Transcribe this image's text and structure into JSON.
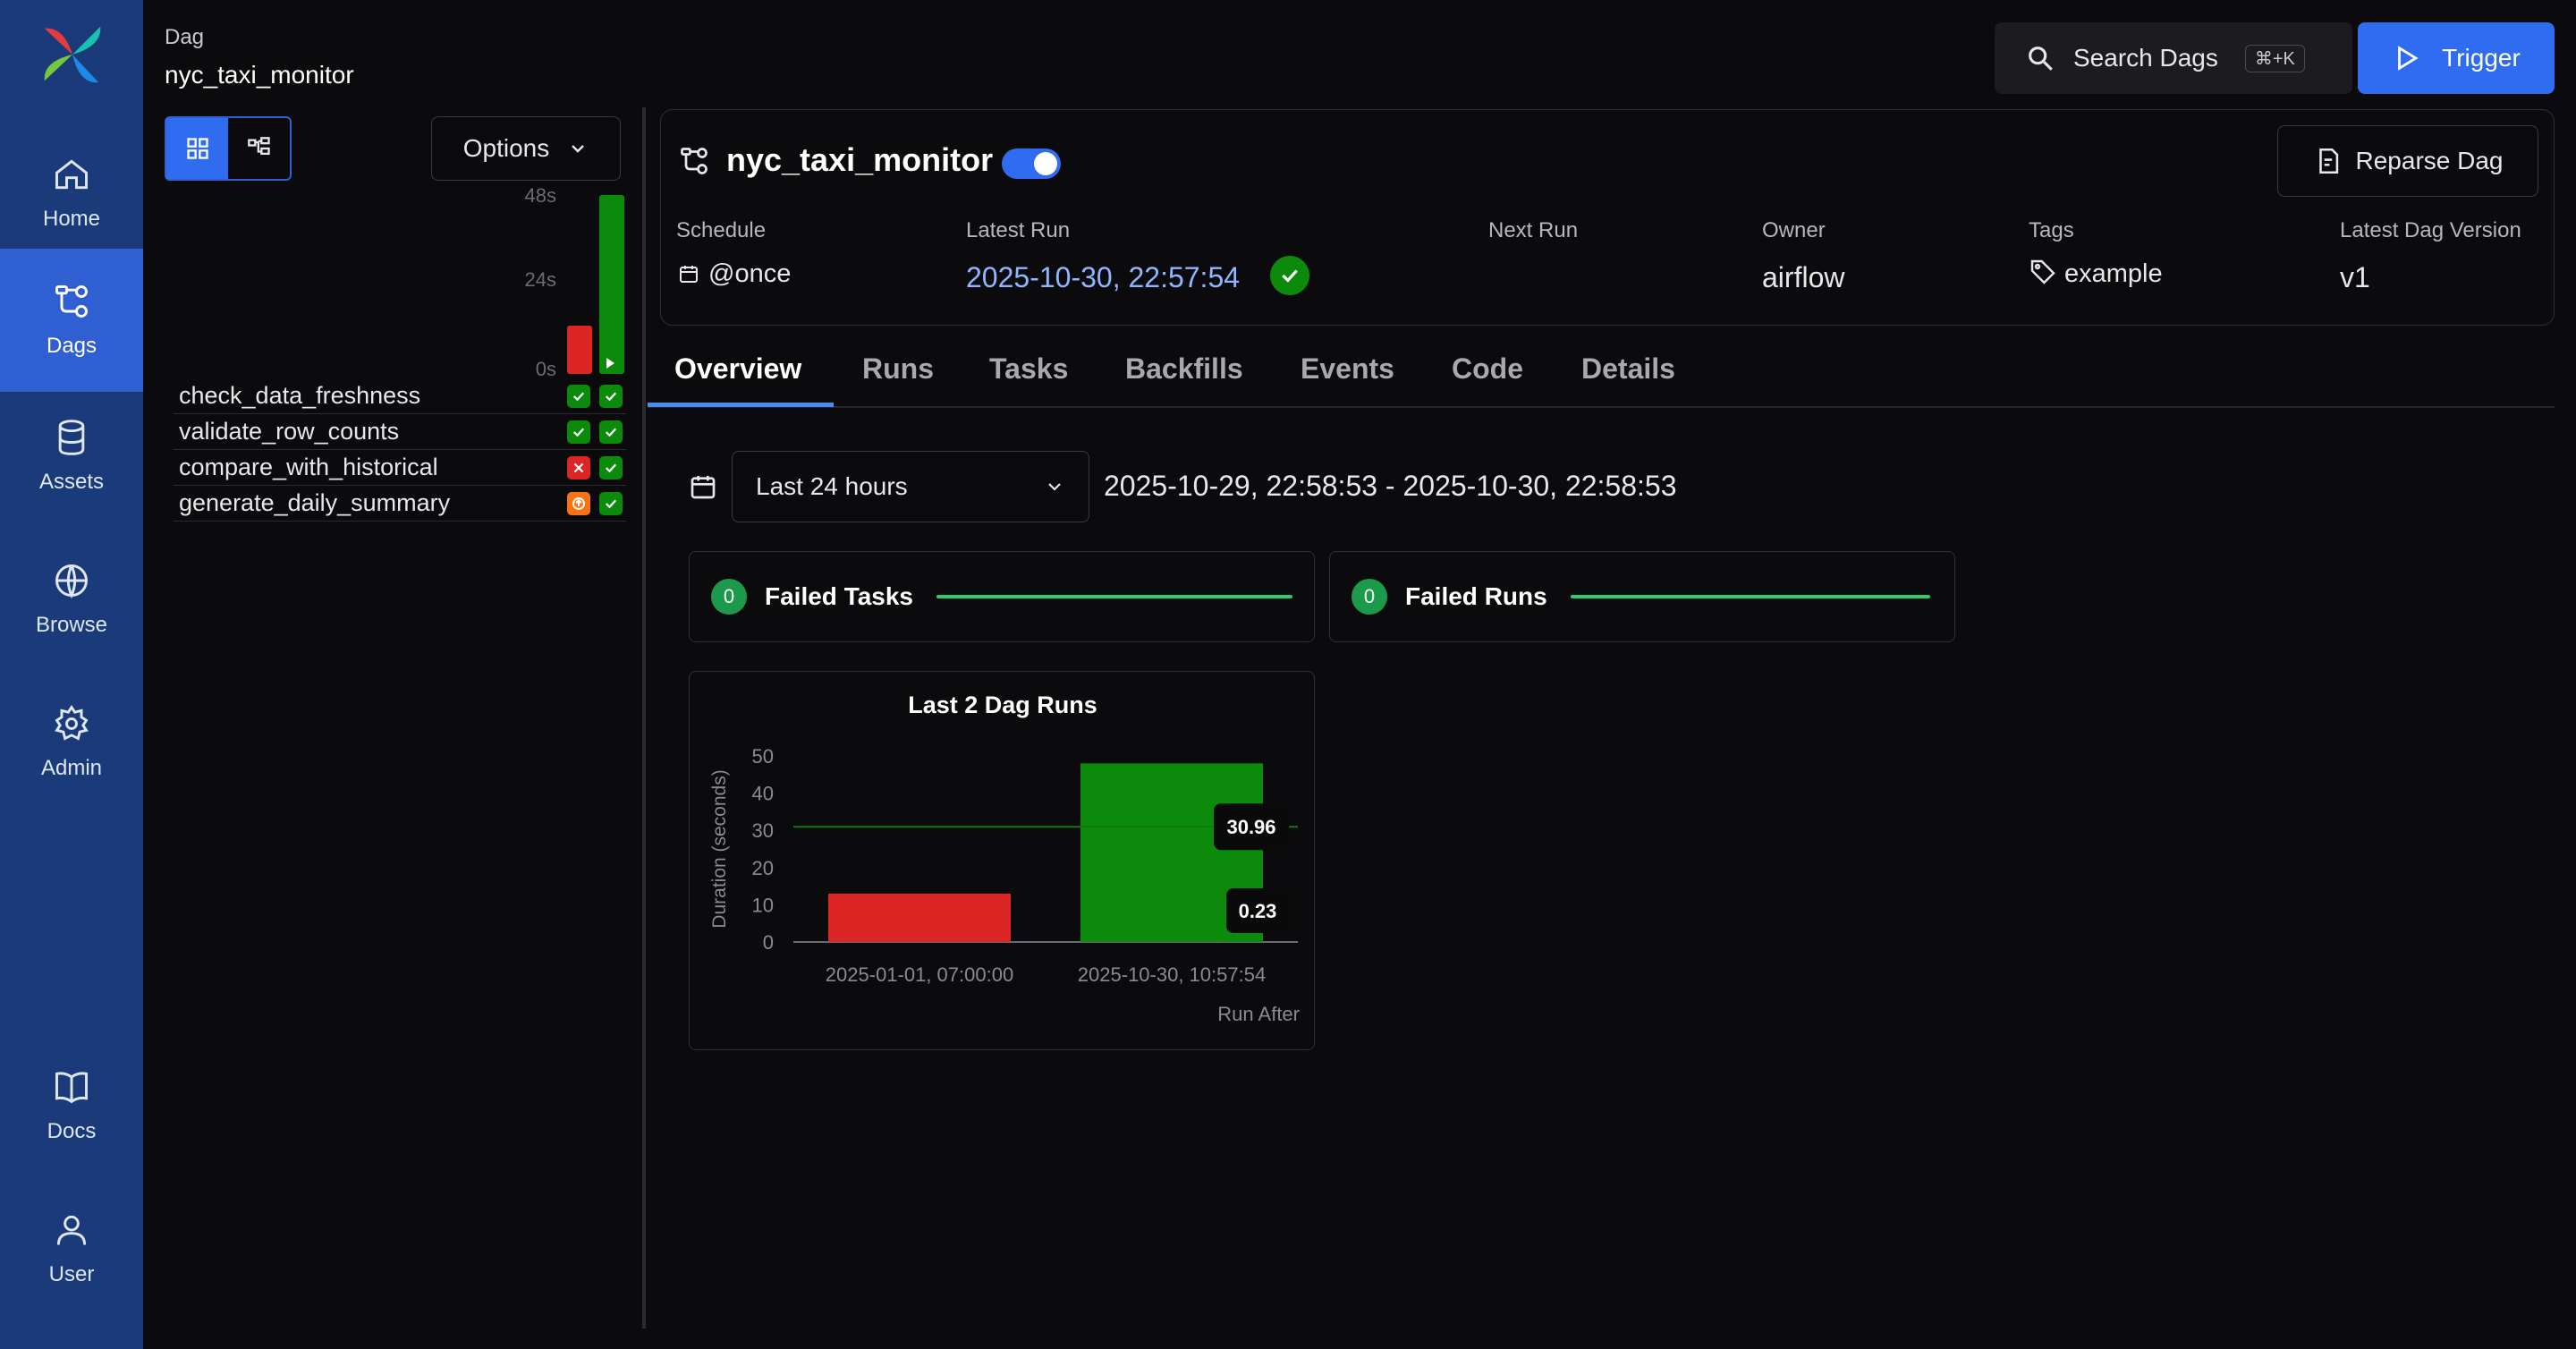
{
  "sidebar": {
    "items": [
      {
        "label": "Home",
        "icon": "home-icon"
      },
      {
        "label": "Dags",
        "icon": "dags-icon",
        "active": true
      },
      {
        "label": "Assets",
        "icon": "database-icon"
      },
      {
        "label": "Browse",
        "icon": "globe-icon"
      },
      {
        "label": "Admin",
        "icon": "gear-icon"
      },
      {
        "label": "Docs",
        "icon": "book-icon"
      },
      {
        "label": "User",
        "icon": "user-icon"
      }
    ]
  },
  "header": {
    "crumb_label": "Dag",
    "dag_id": "nyc_taxi_monitor",
    "search_label": "Search Dags",
    "search_shortcut": "⌘+K",
    "trigger_label": "Trigger"
  },
  "left_panel": {
    "options_label": "Options",
    "duration_ticks": [
      "48s",
      "24s",
      "0s"
    ],
    "tasks": [
      {
        "name": "check_data_freshness",
        "states": [
          "success",
          "success"
        ]
      },
      {
        "name": "validate_row_counts",
        "states": [
          "success",
          "success"
        ]
      },
      {
        "name": "compare_with_historical",
        "states": [
          "failed",
          "success"
        ]
      },
      {
        "name": "generate_daily_summary",
        "states": [
          "upstream_failed",
          "success"
        ]
      }
    ],
    "run_bars": [
      {
        "state": "failed",
        "duration": 0.23
      },
      {
        "state": "success",
        "duration": 30.96
      }
    ]
  },
  "dag_info": {
    "title": "nyc_taxi_monitor",
    "paused": false,
    "reparse_label": "Reparse Dag",
    "schedule_label": "Schedule",
    "schedule_value": "@once",
    "latest_run_label": "Latest Run",
    "latest_run_value": "2025-10-30, 22:57:54",
    "next_run_label": "Next Run",
    "owner_label": "Owner",
    "owner_value": "airflow",
    "tags_label": "Tags",
    "tags_value": "example",
    "version_label": "Latest Dag Version",
    "version_value": "v1"
  },
  "tabs": [
    "Overview",
    "Runs",
    "Tasks",
    "Backfills",
    "Events",
    "Code",
    "Details"
  ],
  "overview": {
    "range_select": "Last 24 hours",
    "range_text": "2025-10-29, 22:58:53 - 2025-10-30, 22:58:53",
    "failed_tasks": {
      "count": "0",
      "label": "Failed Tasks"
    },
    "failed_runs": {
      "count": "0",
      "label": "Failed Runs"
    }
  },
  "colors": {
    "sidebar": "#1b3a7a",
    "accent": "#2f6cf0",
    "success": "#0b8a0b",
    "failed": "#dc2626",
    "upstream_failed": "#f97316"
  },
  "chart_data": {
    "type": "bar",
    "title": "Last 2 Dag Runs",
    "xlabel": "Run After",
    "ylabel": "Duration (seconds)",
    "ylim": [
      0,
      50
    ],
    "yticks": [
      0,
      10,
      20,
      30,
      40,
      50
    ],
    "categories": [
      "2025-01-01, 07:00:00",
      "2025-10-30, 10:57:54"
    ],
    "values": [
      13,
      48
    ],
    "bar_colors": [
      "#dc2626",
      "#0b8a0b"
    ],
    "reference_lines": [
      {
        "value": 30.96,
        "label": "30.96"
      },
      {
        "value": 0.23,
        "label": "0.23"
      }
    ]
  }
}
